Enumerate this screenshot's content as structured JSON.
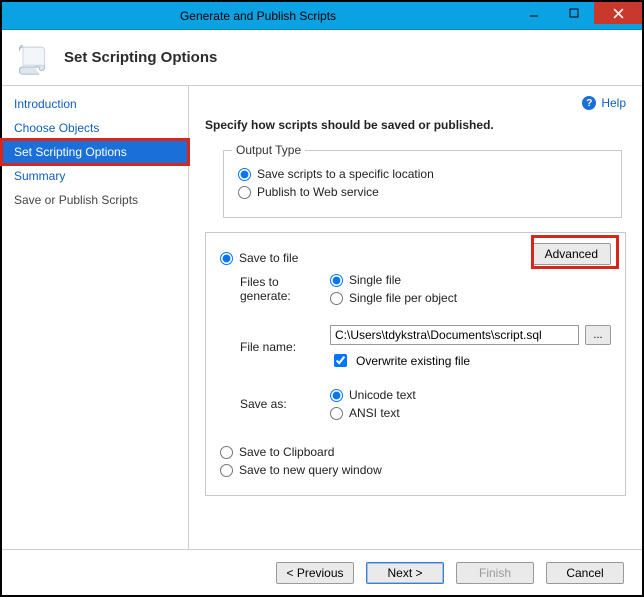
{
  "window": {
    "title": "Generate and Publish Scripts"
  },
  "header": {
    "title": "Set Scripting Options"
  },
  "sidebar": {
    "items": [
      {
        "label": "Introduction"
      },
      {
        "label": "Choose Objects"
      },
      {
        "label": "Set Scripting Options"
      },
      {
        "label": "Summary"
      },
      {
        "label": "Save or Publish Scripts"
      }
    ]
  },
  "help": {
    "label": "Help"
  },
  "instruction": "Specify how scripts should be saved or published.",
  "outputType": {
    "legend": "Output Type",
    "save_location": "Save scripts to a specific location",
    "publish_web": "Publish to Web service"
  },
  "saveGroup": {
    "save_to_file": "Save to file",
    "advanced_label": "Advanced",
    "files_to_generate_label": "Files to generate:",
    "single_file": "Single file",
    "single_per_object": "Single file per object",
    "file_name_label": "File name:",
    "file_name_value": "C:\\Users\\tdykstra\\Documents\\script.sql",
    "overwrite": "Overwrite existing file",
    "save_as_label": "Save as:",
    "unicode": "Unicode text",
    "ansi": "ANSI text",
    "save_clipboard": "Save to Clipboard",
    "save_new_query": "Save to new query window"
  },
  "footer": {
    "previous": "< Previous",
    "next": "Next >",
    "finish": "Finish",
    "cancel": "Cancel"
  }
}
